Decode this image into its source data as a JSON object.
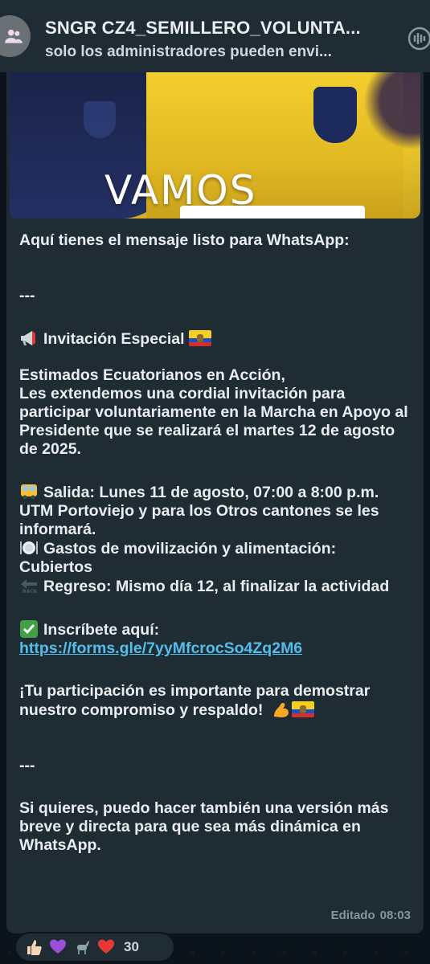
{
  "header": {
    "title": "SNGR CZ4_SEMILLERO_VOLUNTA...",
    "subtitle": "solo los administradores pueden envi..."
  },
  "image": {
    "banner_text": "VAMOS"
  },
  "message": {
    "line_intro": "Aquí tienes el mensaje listo para WhatsApp:",
    "divider1": "---",
    "invite_title": "Invitación Especial",
    "greeting": "Estimados Ecuatorianos en Acción,",
    "body": "Les extendemos una cordial invitación para participar voluntariamente en la Marcha en Apoyo al Presidente que se realizará el martes 12 de agosto de 2025.",
    "salida": "Salida: Lunes 11 de agosto, 07:00 a 8:00 p.m. UTM Portoviejo y para los Otros cantones se les informará.",
    "gastos": "Gastos de movilización y alimentación: Cubiertos",
    "regreso": "Regreso: Mismo día 12, al finalizar la actividad",
    "inscribete_label": "Inscríbete aquí:",
    "inscribete_link": "https://forms.gle/7yyMfcrocSo4Zq2M6",
    "closing": "¡Tu participación es importante para demostrar nuestro compromiso y respaldo!",
    "divider2": "---",
    "footer_note": "Si quieres, puedo hacer también una versión más breve y directa para que sea más dinámica en WhatsApp.",
    "edited_label": "Editado",
    "time": "08:03"
  },
  "reactions": {
    "count": "30"
  }
}
